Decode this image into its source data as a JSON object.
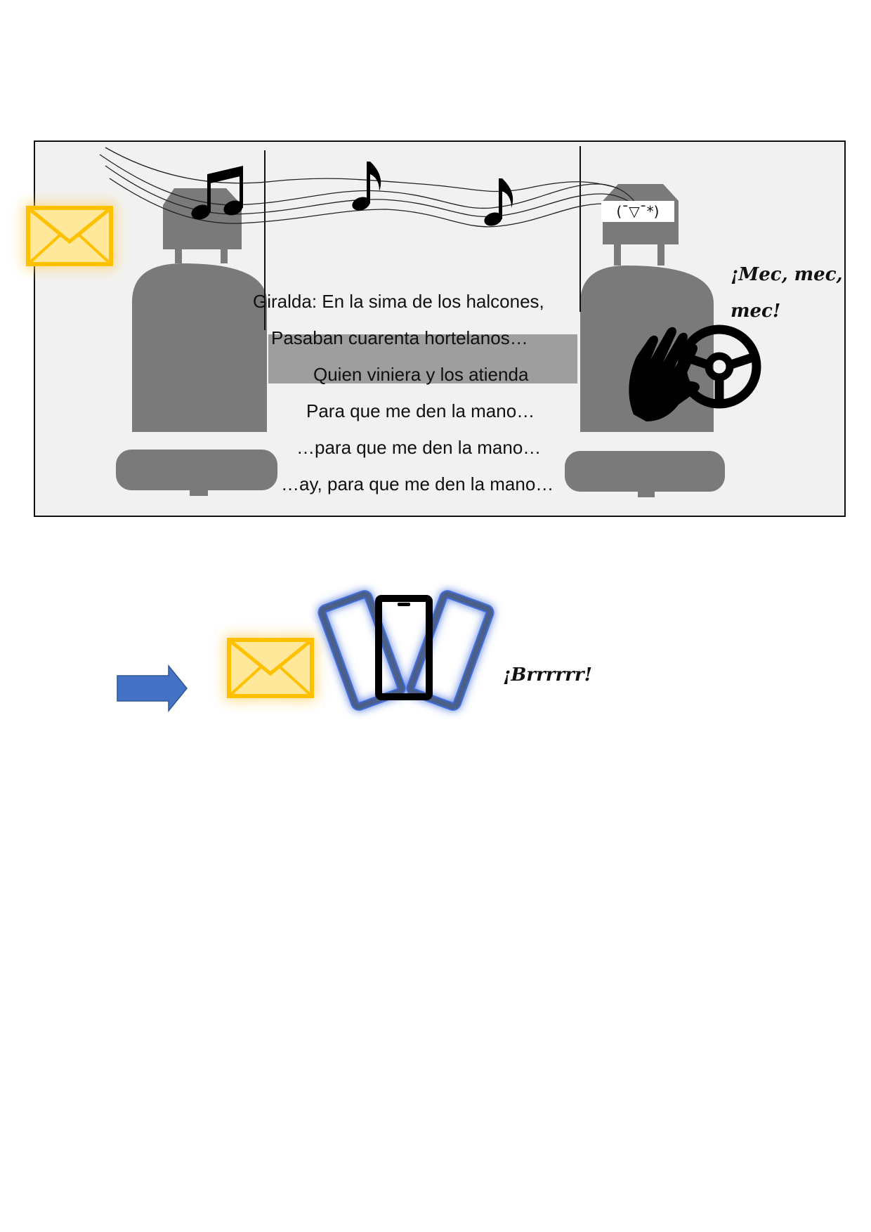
{
  "panel": {
    "lyrics": [
      "Giralda: En la sima de los halcones,",
      "Pasaban cuarenta hortelanos…",
      "Quien viniera y los atienda",
      "Para que me den la mano…",
      "…para que me den la mano…",
      "…ay, para que me den la mano…"
    ],
    "face_emoticon": "(¯▽¯*)",
    "honk_text_line1": "¡Mec, mec,",
    "honk_text_line2": "mec!"
  },
  "notification": {
    "vibration_text": "¡Brrrrrr!"
  },
  "icons": {
    "envelope": "envelope-icon",
    "music_notes": "music-notes-icon",
    "steering_wheel": "steering-wheel-icon",
    "hand": "hand-icon",
    "phone": "vibrating-phone-icon",
    "arrow": "right-arrow-icon"
  },
  "colors": {
    "envelope_yellow": "#FFC000",
    "seat_gray": "#7a7a7a",
    "arrow_blue": "#4472C4",
    "phone_glow": "#2a5bd7"
  }
}
